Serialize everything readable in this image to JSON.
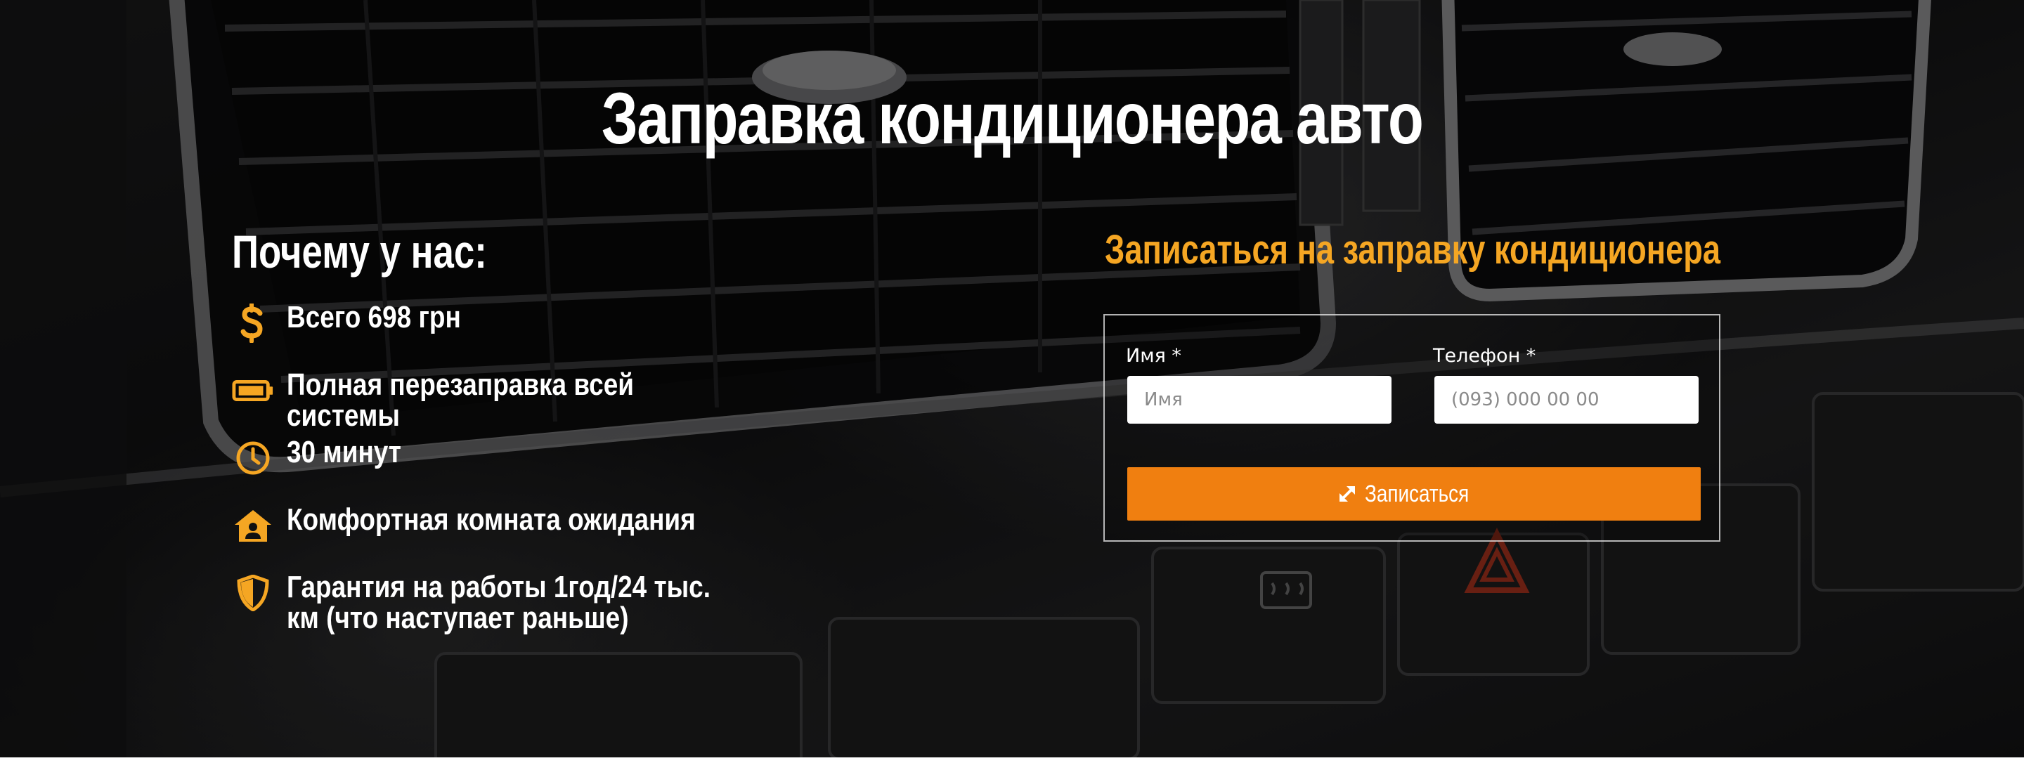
{
  "hero": {
    "title": "Заправка кондиционера авто",
    "background": "dark car dashboard air vent photo"
  },
  "why": {
    "title": "Почему у нас:",
    "features": [
      {
        "icon": "dollar-icon",
        "text": "Всего 698 грн"
      },
      {
        "icon": "battery-icon",
        "text": "Полная перезаправка всей системы"
      },
      {
        "icon": "clock-icon",
        "text": "30 минут"
      },
      {
        "icon": "house-user-icon",
        "text": "Комфортная комната ожидания"
      },
      {
        "icon": "shield-icon",
        "text": "Гарантия на работы 1год/24 тыс. км (что наступает раньше)"
      }
    ]
  },
  "form": {
    "title": "Записаться на заправку кондиционера",
    "name_label": "Имя *",
    "name_placeholder": "Имя",
    "phone_label": "Телефон *",
    "phone_placeholder": "(093) 000 00 00",
    "submit_label": "Записаться",
    "submit_icon": "expand-arrows-icon"
  },
  "colors": {
    "accent": "#f5a623",
    "button": "#f07f10",
    "text": "#ffffff"
  }
}
